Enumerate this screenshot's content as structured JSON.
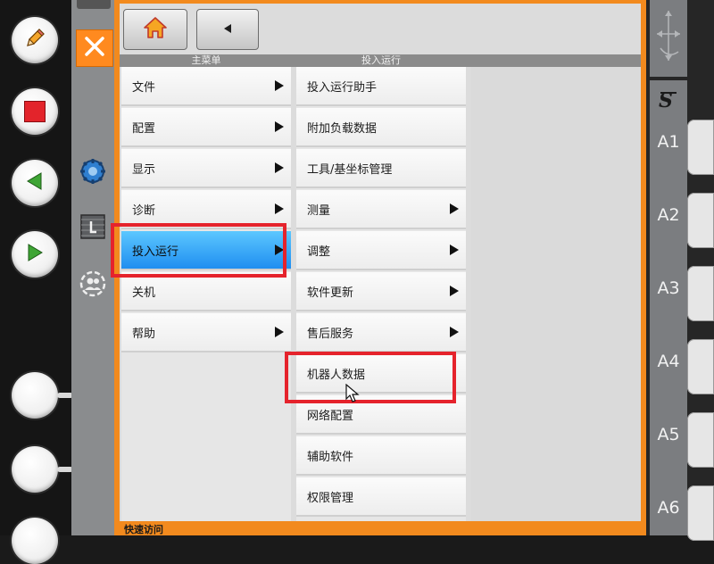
{
  "header": {
    "main_menu": "主菜单",
    "submenu": "投入运行"
  },
  "main_menu": [
    {
      "label": "文件",
      "submenu": true
    },
    {
      "label": "配置",
      "submenu": true
    },
    {
      "label": "显示",
      "submenu": true
    },
    {
      "label": "诊断",
      "submenu": true
    },
    {
      "label": "投入运行",
      "submenu": true,
      "selected": true
    },
    {
      "label": "关机",
      "submenu": false
    },
    {
      "label": "帮助",
      "submenu": true
    }
  ],
  "submenu": [
    {
      "label": "投入运行助手",
      "submenu": false
    },
    {
      "label": "附加负载数据",
      "submenu": false
    },
    {
      "label": "工具/基坐标管理",
      "submenu": false
    },
    {
      "label": "测量",
      "submenu": true
    },
    {
      "label": "调整",
      "submenu": true
    },
    {
      "label": "软件更新",
      "submenu": true
    },
    {
      "label": "售后服务",
      "submenu": true
    },
    {
      "label": "机器人数据",
      "submenu": false,
      "highlighted": true
    },
    {
      "label": "网络配置",
      "submenu": false
    },
    {
      "label": "辅助软件",
      "submenu": false
    },
    {
      "label": "权限管理",
      "submenu": false
    }
  ],
  "quick_access": "快速访问",
  "axes": [
    "A1",
    "A2",
    "A3",
    "A4",
    "A5",
    "A6"
  ],
  "colors": {
    "frame": "#f28a1e",
    "selected": "#1f8ef0",
    "highlight_box": "#e5232c"
  }
}
